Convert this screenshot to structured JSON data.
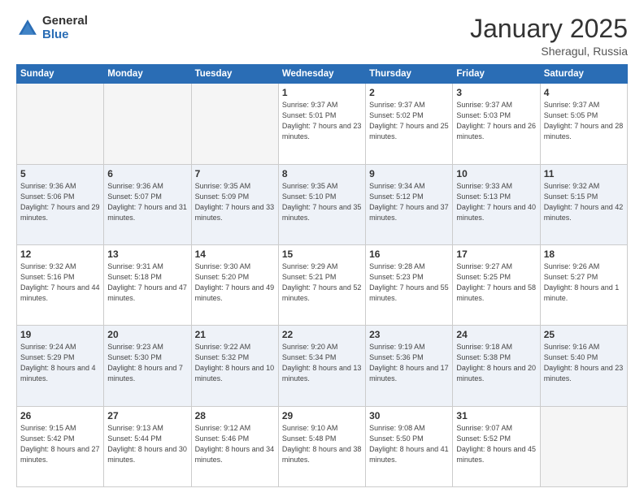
{
  "header": {
    "logo_general": "General",
    "logo_blue": "Blue",
    "month_title": "January 2025",
    "location": "Sheragul, Russia"
  },
  "days_of_week": [
    "Sunday",
    "Monday",
    "Tuesday",
    "Wednesday",
    "Thursday",
    "Friday",
    "Saturday"
  ],
  "weeks": [
    [
      {
        "num": "",
        "empty": true
      },
      {
        "num": "",
        "empty": true
      },
      {
        "num": "",
        "empty": true
      },
      {
        "num": "1",
        "sunrise": "9:37 AM",
        "sunset": "5:01 PM",
        "daylight": "7 hours and 23 minutes."
      },
      {
        "num": "2",
        "sunrise": "9:37 AM",
        "sunset": "5:02 PM",
        "daylight": "7 hours and 25 minutes."
      },
      {
        "num": "3",
        "sunrise": "9:37 AM",
        "sunset": "5:03 PM",
        "daylight": "7 hours and 26 minutes."
      },
      {
        "num": "4",
        "sunrise": "9:37 AM",
        "sunset": "5:05 PM",
        "daylight": "7 hours and 28 minutes."
      }
    ],
    [
      {
        "num": "5",
        "sunrise": "9:36 AM",
        "sunset": "5:06 PM",
        "daylight": "7 hours and 29 minutes."
      },
      {
        "num": "6",
        "sunrise": "9:36 AM",
        "sunset": "5:07 PM",
        "daylight": "7 hours and 31 minutes."
      },
      {
        "num": "7",
        "sunrise": "9:35 AM",
        "sunset": "5:09 PM",
        "daylight": "7 hours and 33 minutes."
      },
      {
        "num": "8",
        "sunrise": "9:35 AM",
        "sunset": "5:10 PM",
        "daylight": "7 hours and 35 minutes."
      },
      {
        "num": "9",
        "sunrise": "9:34 AM",
        "sunset": "5:12 PM",
        "daylight": "7 hours and 37 minutes."
      },
      {
        "num": "10",
        "sunrise": "9:33 AM",
        "sunset": "5:13 PM",
        "daylight": "7 hours and 40 minutes."
      },
      {
        "num": "11",
        "sunrise": "9:32 AM",
        "sunset": "5:15 PM",
        "daylight": "7 hours and 42 minutes."
      }
    ],
    [
      {
        "num": "12",
        "sunrise": "9:32 AM",
        "sunset": "5:16 PM",
        "daylight": "7 hours and 44 minutes."
      },
      {
        "num": "13",
        "sunrise": "9:31 AM",
        "sunset": "5:18 PM",
        "daylight": "7 hours and 47 minutes."
      },
      {
        "num": "14",
        "sunrise": "9:30 AM",
        "sunset": "5:20 PM",
        "daylight": "7 hours and 49 minutes."
      },
      {
        "num": "15",
        "sunrise": "9:29 AM",
        "sunset": "5:21 PM",
        "daylight": "7 hours and 52 minutes."
      },
      {
        "num": "16",
        "sunrise": "9:28 AM",
        "sunset": "5:23 PM",
        "daylight": "7 hours and 55 minutes."
      },
      {
        "num": "17",
        "sunrise": "9:27 AM",
        "sunset": "5:25 PM",
        "daylight": "7 hours and 58 minutes."
      },
      {
        "num": "18",
        "sunrise": "9:26 AM",
        "sunset": "5:27 PM",
        "daylight": "8 hours and 1 minute."
      }
    ],
    [
      {
        "num": "19",
        "sunrise": "9:24 AM",
        "sunset": "5:29 PM",
        "daylight": "8 hours and 4 minutes."
      },
      {
        "num": "20",
        "sunrise": "9:23 AM",
        "sunset": "5:30 PM",
        "daylight": "8 hours and 7 minutes."
      },
      {
        "num": "21",
        "sunrise": "9:22 AM",
        "sunset": "5:32 PM",
        "daylight": "8 hours and 10 minutes."
      },
      {
        "num": "22",
        "sunrise": "9:20 AM",
        "sunset": "5:34 PM",
        "daylight": "8 hours and 13 minutes."
      },
      {
        "num": "23",
        "sunrise": "9:19 AM",
        "sunset": "5:36 PM",
        "daylight": "8 hours and 17 minutes."
      },
      {
        "num": "24",
        "sunrise": "9:18 AM",
        "sunset": "5:38 PM",
        "daylight": "8 hours and 20 minutes."
      },
      {
        "num": "25",
        "sunrise": "9:16 AM",
        "sunset": "5:40 PM",
        "daylight": "8 hours and 23 minutes."
      }
    ],
    [
      {
        "num": "26",
        "sunrise": "9:15 AM",
        "sunset": "5:42 PM",
        "daylight": "8 hours and 27 minutes."
      },
      {
        "num": "27",
        "sunrise": "9:13 AM",
        "sunset": "5:44 PM",
        "daylight": "8 hours and 30 minutes."
      },
      {
        "num": "28",
        "sunrise": "9:12 AM",
        "sunset": "5:46 PM",
        "daylight": "8 hours and 34 minutes."
      },
      {
        "num": "29",
        "sunrise": "9:10 AM",
        "sunset": "5:48 PM",
        "daylight": "8 hours and 38 minutes."
      },
      {
        "num": "30",
        "sunrise": "9:08 AM",
        "sunset": "5:50 PM",
        "daylight": "8 hours and 41 minutes."
      },
      {
        "num": "31",
        "sunrise": "9:07 AM",
        "sunset": "5:52 PM",
        "daylight": "8 hours and 45 minutes."
      },
      {
        "num": "",
        "empty": true
      }
    ]
  ]
}
